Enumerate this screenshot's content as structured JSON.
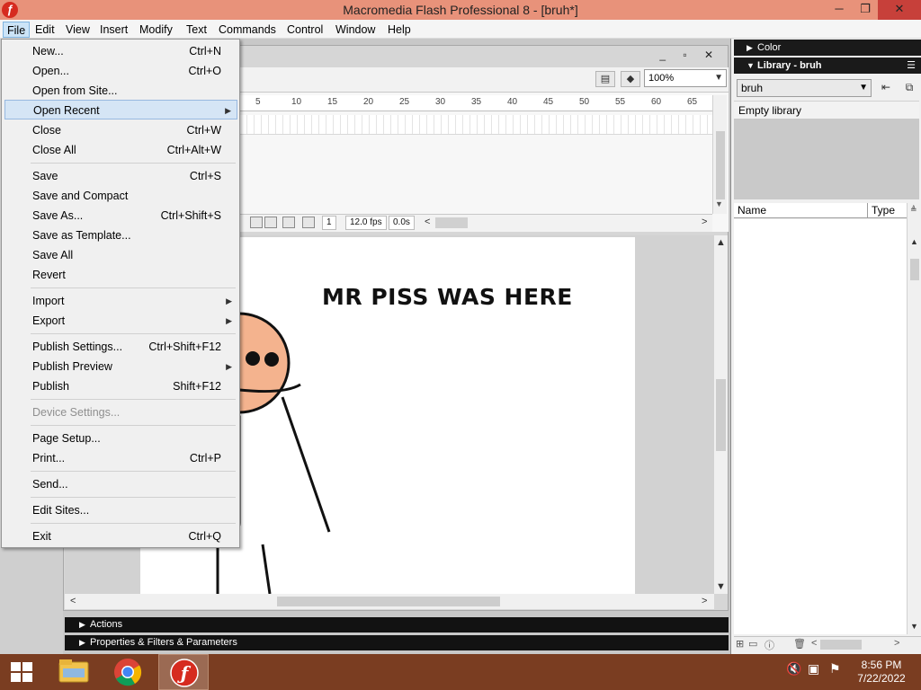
{
  "window": {
    "title": "Macromedia Flash Professional 8 - [bruh*]",
    "min_label": "─",
    "max_label": "❐",
    "close_label": "✕"
  },
  "menubar": [
    "File",
    "Edit",
    "View",
    "Insert",
    "Modify",
    "Text",
    "Commands",
    "Control",
    "Window",
    "Help"
  ],
  "file_menu": {
    "items": [
      {
        "label": "New...",
        "shortcut": "Ctrl+N"
      },
      {
        "label": "Open...",
        "shortcut": "Ctrl+O"
      },
      {
        "label": "Open from Site...",
        "shortcut": ""
      },
      {
        "label": "Open Recent",
        "shortcut": "",
        "submenu": true,
        "highlighted": true
      },
      {
        "label": "Close",
        "shortcut": "Ctrl+W"
      },
      {
        "label": "Close All",
        "shortcut": "Ctrl+Alt+W"
      },
      {
        "label": "Save",
        "shortcut": "Ctrl+S"
      },
      {
        "label": "Save and Compact",
        "shortcut": ""
      },
      {
        "label": "Save As...",
        "shortcut": "Ctrl+Shift+S"
      },
      {
        "label": "Save as Template...",
        "shortcut": ""
      },
      {
        "label": "Save All",
        "shortcut": ""
      },
      {
        "label": "Revert",
        "shortcut": ""
      },
      {
        "label": "Import",
        "shortcut": "",
        "submenu": true
      },
      {
        "label": "Export",
        "shortcut": "",
        "submenu": true
      },
      {
        "label": "Publish Settings...",
        "shortcut": "Ctrl+Shift+F12"
      },
      {
        "label": "Publish Preview",
        "shortcut": "",
        "submenu": true
      },
      {
        "label": "Publish",
        "shortcut": "Shift+F12"
      },
      {
        "label": "Device Settings...",
        "shortcut": "",
        "disabled": true
      },
      {
        "label": "Page Setup...",
        "shortcut": ""
      },
      {
        "label": "Print...",
        "shortcut": "Ctrl+P"
      },
      {
        "label": "Send...",
        "shortcut": ""
      },
      {
        "label": "Edit Sites...",
        "shortcut": ""
      },
      {
        "label": "Exit",
        "shortcut": "Ctrl+Q"
      }
    ]
  },
  "document": {
    "zoom": "100%",
    "window_buttons": "_ ▫ ✕",
    "ruler_ticks": [
      "5",
      "10",
      "15",
      "20",
      "25",
      "30",
      "35",
      "40",
      "45",
      "50",
      "55",
      "60",
      "65"
    ],
    "current_frame": "1",
    "frame_rate": "12.0 fps",
    "elapsed_time": "0.0s",
    "stage_text": "MR PISS WAS HERE"
  },
  "panels": {
    "actions": "Actions",
    "properties": "Properties & Filters & Parameters",
    "color": "Color",
    "library_title": "Library - bruh",
    "library_select": "bruh",
    "library_status": "Empty library",
    "col_name": "Name",
    "col_type": "Type"
  },
  "taskbar": {
    "time": "8:56 PM",
    "date": "7/22/2022"
  },
  "colors": {
    "titlebar": "#e8927a",
    "close_button": "#c7403a",
    "taskbar": "#7a3d21",
    "menu_highlight": "#d5e5f5",
    "figure_shirt": "#2c3de6",
    "figure_skin": "#f4b38e"
  },
  "icons": [
    "flash-app-icon",
    "windows-start-icon",
    "file-explorer-icon",
    "chrome-icon",
    "flash-taskbar-icon",
    "volume-muted-icon",
    "network-icon",
    "action-center-icon"
  ]
}
